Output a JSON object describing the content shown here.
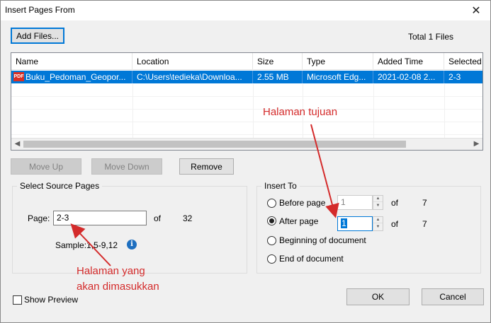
{
  "window": {
    "title": "Insert Pages From",
    "close_glyph": "✕"
  },
  "toolbar": {
    "add_files_label": "Add Files...",
    "total_files": "Total 1 Files"
  },
  "file_list": {
    "columns": [
      "Name",
      "Location",
      "Size",
      "Type",
      "Added Time",
      "Selected"
    ],
    "rows": [
      {
        "icon_text": "PDF",
        "name": "Buku_Pedoman_Geopor...",
        "location": "C:\\Users\\tedieka\\Downloa...",
        "size": "2.55 MB",
        "type": "Microsoft Edg...",
        "added_time": "2021-02-08 2...",
        "selected": "2-3"
      }
    ]
  },
  "list_buttons": {
    "move_up": "Move Up",
    "move_down": "Move Down",
    "remove": "Remove"
  },
  "source_pages": {
    "legend": "Select Source Pages",
    "page_label": "Page:",
    "page_value": "2-3",
    "of_label": "of",
    "total_pages": "32",
    "sample": "Sample:1,5-9,12",
    "info_glyph": "i"
  },
  "insert_to": {
    "legend": "Insert To",
    "before_page_label": "Before page",
    "before_page_value": "1",
    "before_of": "of",
    "before_total": "7",
    "after_page_label": "After page",
    "after_page_value": "1",
    "after_of": "of",
    "after_total": "7",
    "beginning_label": "Beginning of document",
    "end_label": "End of document",
    "selected_option": "after_page"
  },
  "footer": {
    "show_preview_label": "Show Preview",
    "ok_label": "OK",
    "cancel_label": "Cancel"
  },
  "annotations": {
    "target_note": "Halaman tujuan",
    "source_note_line1": "Halaman yang",
    "source_note_line2": "akan dimasukkan",
    "color": "#d42b2b"
  },
  "colors": {
    "selection": "#0078d7",
    "dialog_bg": "#f0f0f0"
  }
}
